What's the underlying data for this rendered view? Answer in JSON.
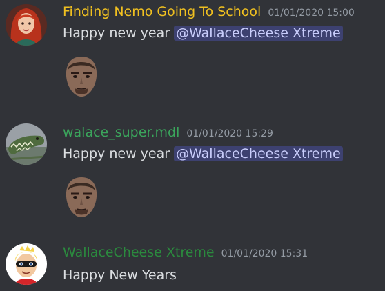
{
  "messages": [
    {
      "username": "Finding Nemo Going To School",
      "username_color": "#f0c020",
      "timestamp": "01/01/2020 15:00",
      "text_prefix": "Happy new year ",
      "mention": "@WallaceCheese Xtreme",
      "avatar_icon": "red-haired-woman-avatar",
      "attachment_icon": "face-emoji-image"
    },
    {
      "username": "walace_super.mdl",
      "username_color": "#3ba55c",
      "timestamp": "01/01/2020 15:29",
      "text_prefix": "Happy new year ",
      "mention": "@WallaceCheese Xtreme",
      "avatar_icon": "crocodile-avatar",
      "attachment_icon": "face-emoji-image"
    },
    {
      "username": "WallaceCheese Xtreme",
      "username_color": "#2b8a3e",
      "timestamp": "01/01/2020 15:31",
      "text": "Happy New Years",
      "avatar_icon": "masked-superhero-kid-avatar"
    }
  ]
}
